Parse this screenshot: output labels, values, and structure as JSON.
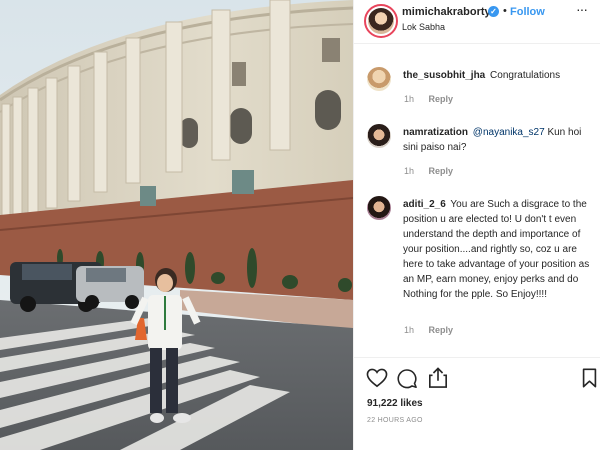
{
  "post": {
    "username": "mimichakraborty",
    "separator": "•",
    "follow_label": "Follow",
    "location": "Lok Sabha",
    "more_label": "···"
  },
  "comments": [
    {
      "username": "the_susobhit_jha",
      "text": "Congratulations",
      "time": "1h",
      "reply_label": "Reply"
    },
    {
      "username": "namratization",
      "mention": "@nayanika_s27",
      "text": "Kun hoi sini paiso nai?",
      "time": "1h",
      "reply_label": "Reply"
    },
    {
      "username": "aditi_2_6",
      "text": "You are Such a disgrace to the position u are elected to! U don't t even understand the depth and importance of your position....and rightly so, coz u are here to take advantage of your position as an MP, earn money, enjoy perks and do Nothing for the pple. So Enjoy!!!!",
      "time": "1h",
      "reply_label": "Reply"
    }
  ],
  "footer": {
    "likes": "91,222 likes",
    "posted": "22 HOURS AGO"
  },
  "icons": [
    "verified-badge-icon",
    "more-options-icon",
    "heart-icon",
    "comment-icon",
    "share-icon",
    "bookmark-icon"
  ],
  "colors": {
    "link": "#3897f0",
    "muted": "#8e8e8e",
    "text": "#262626",
    "mention": "#003569"
  }
}
